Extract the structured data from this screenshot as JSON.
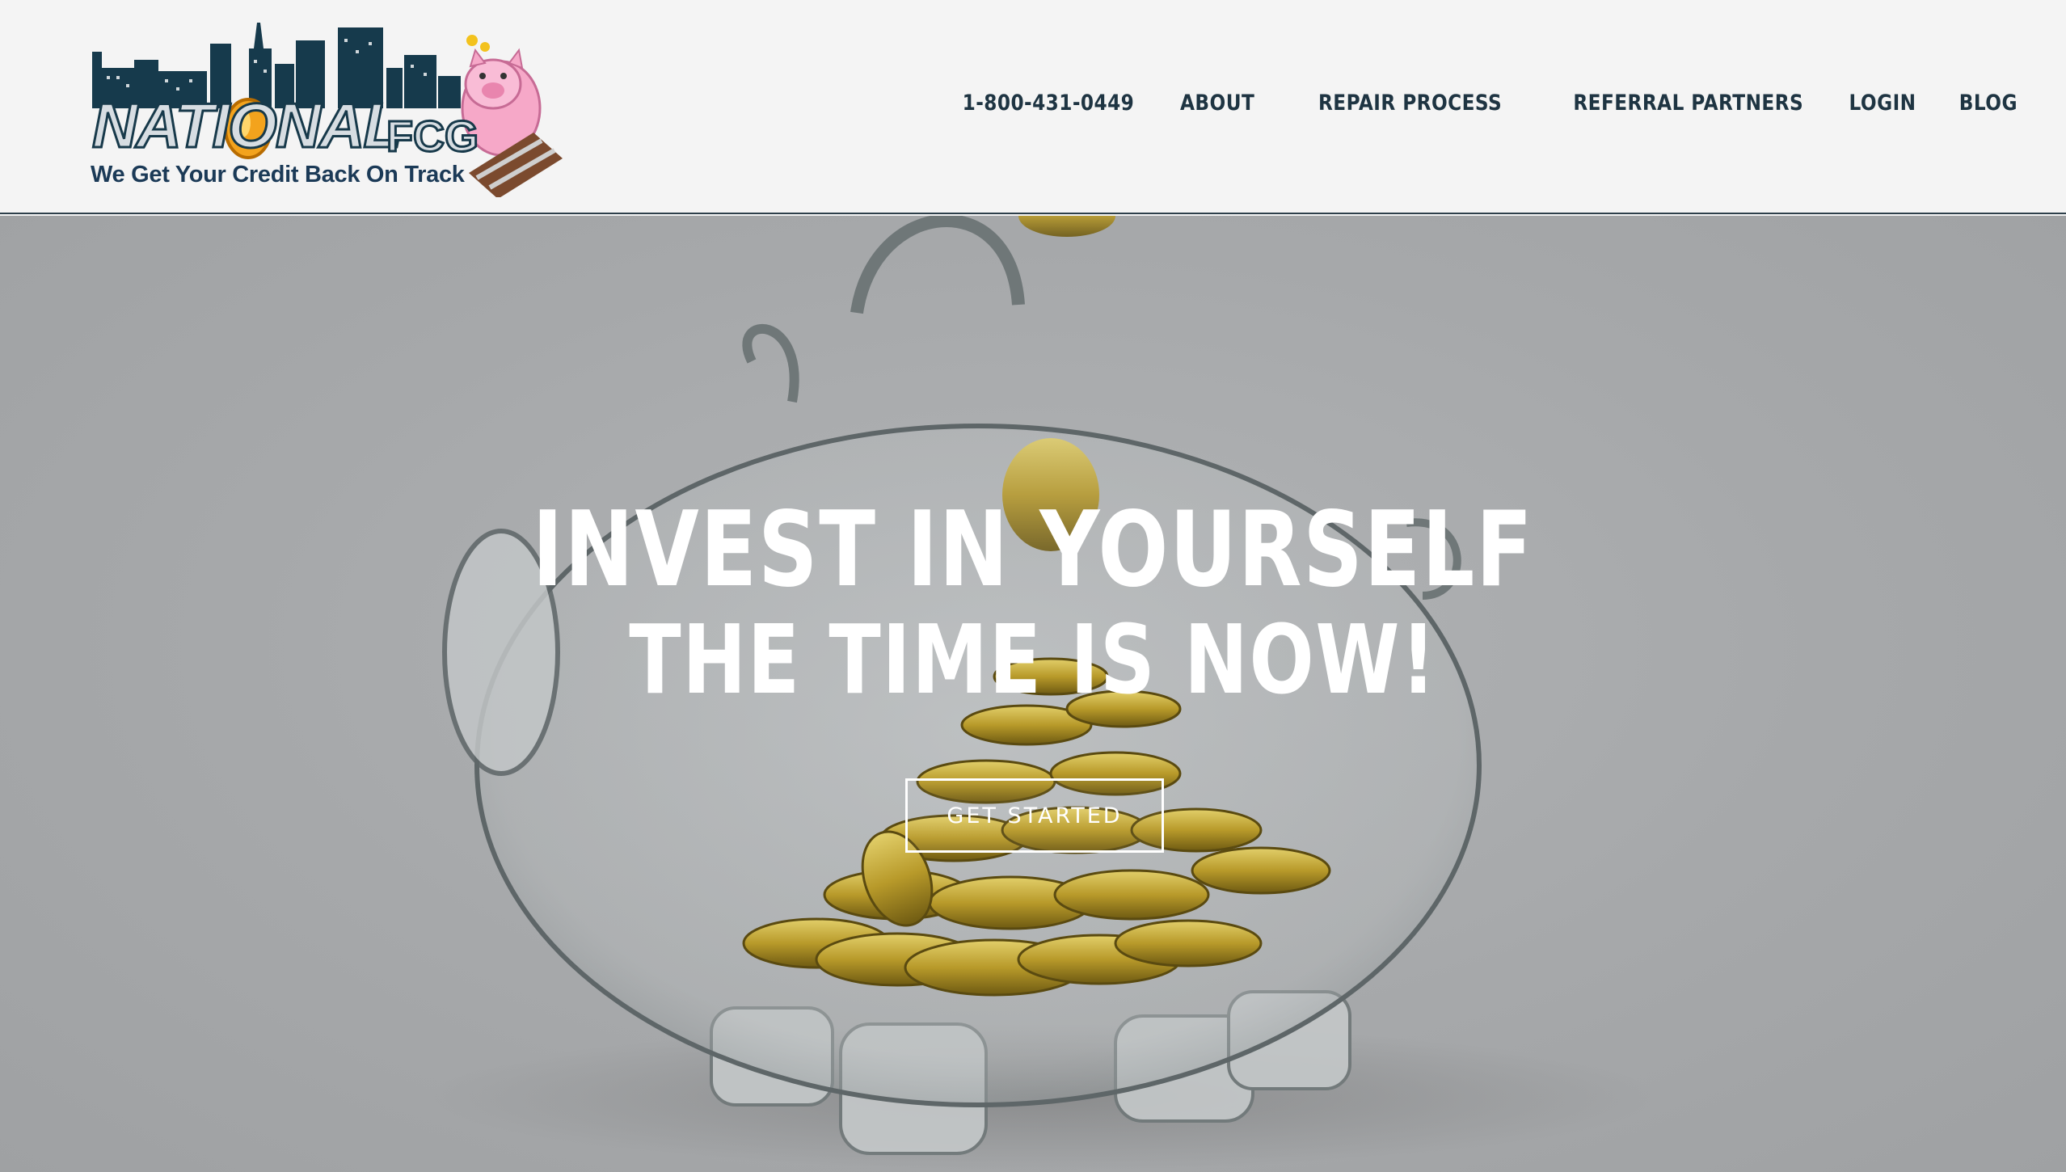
{
  "brand": {
    "name_main": "NATIONAL",
    "name_suffix": "FCG",
    "tagline": "We Get Your Credit Back On Track"
  },
  "nav": {
    "items": [
      {
        "label": "1-800-431-0449"
      },
      {
        "label": "ABOUT"
      },
      {
        "label": "REPAIR PROCESS"
      },
      {
        "label": "REFERRAL PARTNERS"
      },
      {
        "label": "LOGIN"
      },
      {
        "label": "BLOG"
      }
    ]
  },
  "hero": {
    "line1": "INVEST IN YOURSELF",
    "line2": "THE TIME IS NOW!",
    "cta_label": "GET STARTED"
  },
  "colors": {
    "nav_text": "#1e3442",
    "header_bg": "#f4f4f4",
    "hero_overlay": "#a6a8aa",
    "brand_navy": "#17394a"
  }
}
